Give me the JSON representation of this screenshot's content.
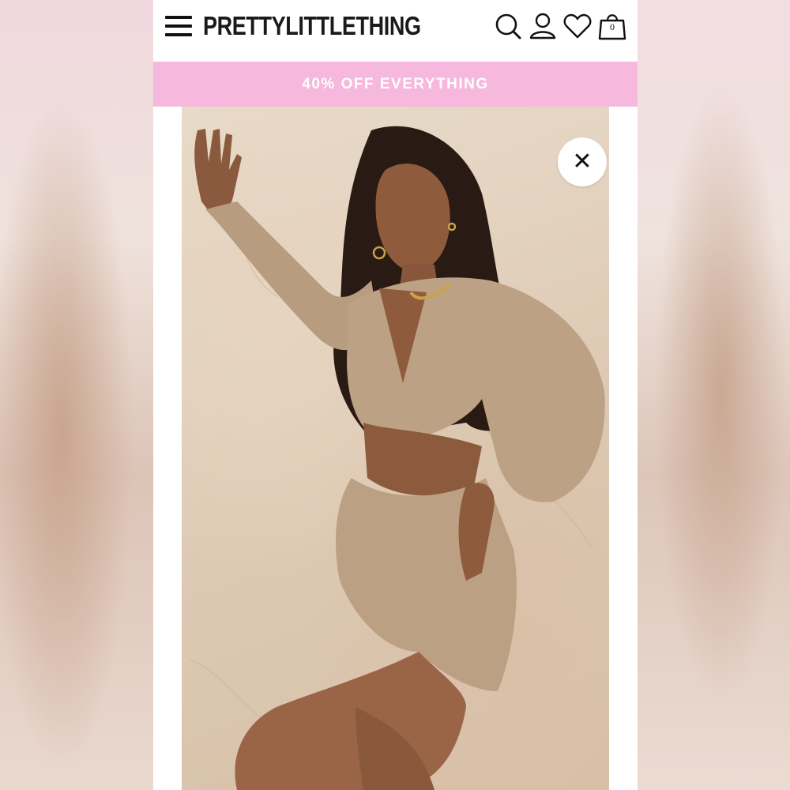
{
  "header": {
    "logo_text": "PRETTYLITTLETHING",
    "menu_icon": "hamburger-menu-icon",
    "search_icon": "search-icon",
    "account_icon": "user-icon",
    "wishlist_icon": "heart-icon",
    "bag_icon": "shopping-bag-icon",
    "bag_count": "0"
  },
  "promo": {
    "text": "40% OFF EVERYTHING",
    "background": "#f6b8dc"
  },
  "gallery": {
    "close_icon": "close-icon",
    "close_symbol": "✕"
  }
}
